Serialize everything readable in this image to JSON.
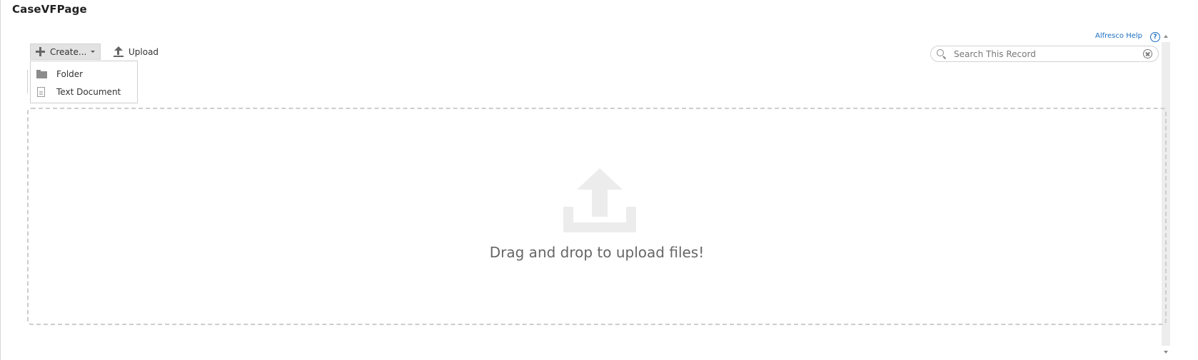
{
  "page": {
    "title": "CaseVFPage"
  },
  "help": {
    "link_label": "Alfresco Help",
    "icon_glyph": "?"
  },
  "toolbar": {
    "create_label": "Create...",
    "upload_label": "Upload"
  },
  "create_menu": {
    "items": [
      {
        "label": "Folder",
        "icon": "folder-icon"
      },
      {
        "label": "Text Document",
        "icon": "document-icon"
      }
    ]
  },
  "search": {
    "placeholder": "Search This Record",
    "value": ""
  },
  "dropzone": {
    "message": "Drag and drop to upload files!",
    "icon": "upload-tray-icon"
  },
  "colors": {
    "link": "#1b6ec2",
    "text": "#333333",
    "dropzone_border": "#cccccc",
    "icon_gray": "#ececec"
  }
}
